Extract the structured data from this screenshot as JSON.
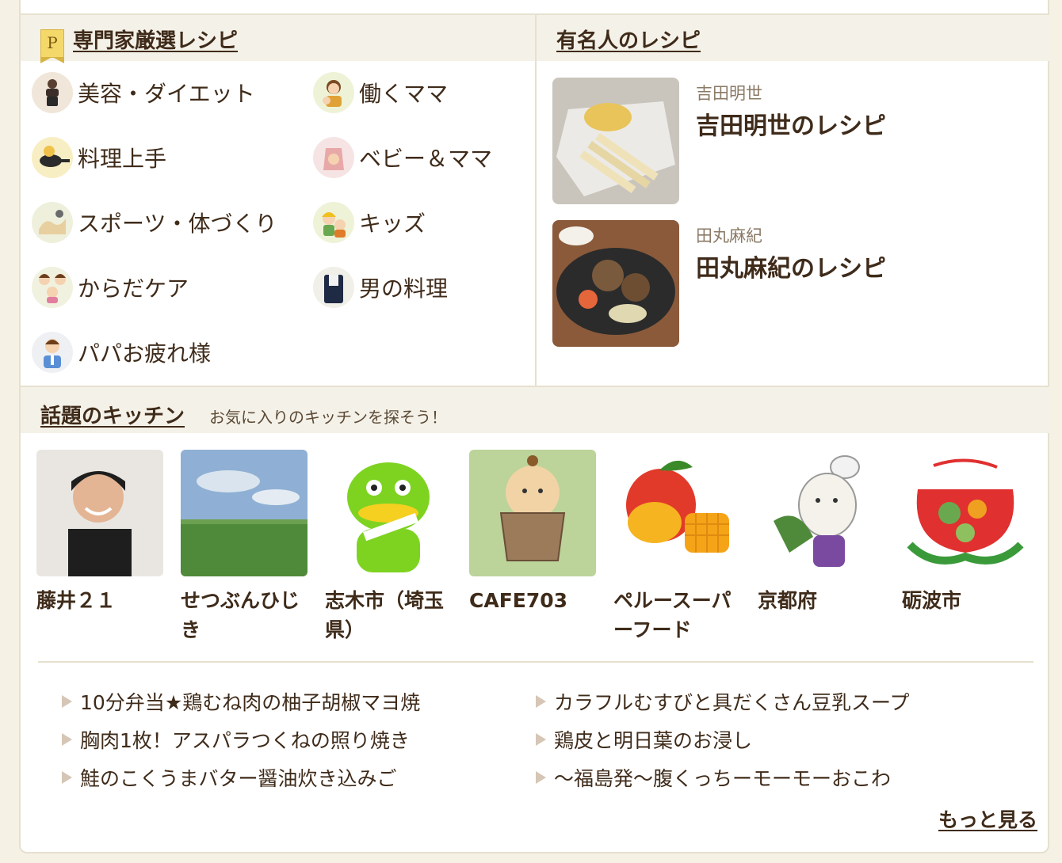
{
  "expert_section": {
    "title": "専門家厳選レシピ",
    "badge": "P",
    "items": [
      {
        "label": "美容・ダイエット",
        "icon": "fitness-woman-icon"
      },
      {
        "label": "働くママ",
        "icon": "working-mom-icon"
      },
      {
        "label": "料理上手",
        "icon": "frying-pan-icon"
      },
      {
        "label": "ベビー＆ママ",
        "icon": "baby-mom-icon"
      },
      {
        "label": "スポーツ・体づくり",
        "icon": "sports-icon"
      },
      {
        "label": "キッズ",
        "icon": "kids-icon"
      },
      {
        "label": "からだケア",
        "icon": "family-icon"
      },
      {
        "label": "男の料理",
        "icon": "man-cooking-icon"
      },
      {
        "label": "パパお疲れ様",
        "icon": "papa-icon"
      }
    ]
  },
  "celebrity_section": {
    "title": "有名人のレシピ",
    "items": [
      {
        "name": "吉田明世",
        "title": "吉田明世のレシピ"
      },
      {
        "name": "田丸麻紀",
        "title": "田丸麻紀のレシピ"
      }
    ]
  },
  "kitchen_section": {
    "title": "話題のキッチン",
    "subtitle": "お気に入りのキッチンを探そう！",
    "kitchens": [
      {
        "name": "藤井２１"
      },
      {
        "name": "せつぶんひじき"
      },
      {
        "name": "志木市（埼玉県）"
      },
      {
        "name": "CAFE703"
      },
      {
        "name": "ペルースーパーフード"
      },
      {
        "name": "京都府"
      },
      {
        "name": "砺波市"
      }
    ],
    "recipes_left": [
      "10分弁当★鶏むね肉の柚子胡椒マヨ焼",
      "胸肉1枚！アスパラつくねの照り焼き",
      "鮭のこくうまバター醤油炊き込みご"
    ],
    "recipes_right": [
      "カラフルむすびと具だくさん豆乳スープ",
      "鶏皮と明日葉のお浸し",
      "～福島発～腹くっちーモーモーおこわ"
    ],
    "more_label": "もっと見る"
  },
  "colors": {
    "page_bg": "#f5f1e4",
    "header_bg": "#f4f1e8",
    "text": "#3f2b1a",
    "muted": "#8a7a66"
  }
}
